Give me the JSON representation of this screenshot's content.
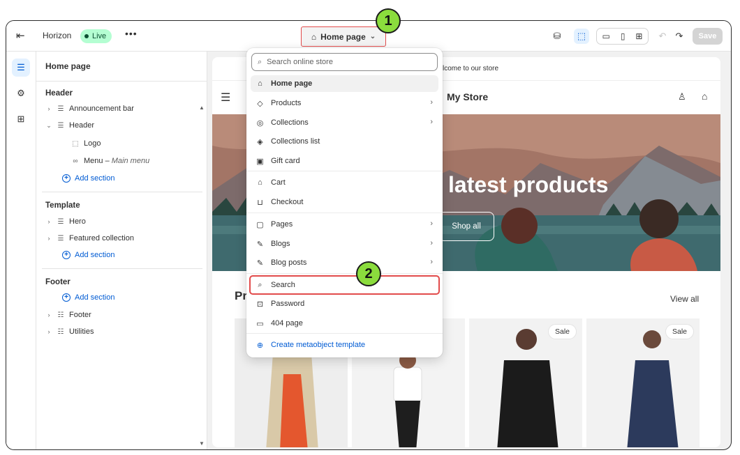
{
  "colors": {
    "accent_blue": "#005bd3",
    "live_badge_bg": "#b4fed2",
    "highlight_red": "#e24b4b",
    "marker_green": "#8bdc3d"
  },
  "topbar": {
    "exit_icon": "exit-icon",
    "theme_name": "Horizon",
    "live_label": "Live",
    "more_icon": "•••",
    "page_selector_label": "Home page",
    "save_label": "Save",
    "icons": [
      "theme-inspector-icon",
      "select-element-icon",
      "desktop-icon",
      "mobile-icon",
      "fullscreen-icon",
      "undo-icon",
      "redo-icon"
    ]
  },
  "rail": {
    "items": [
      "sections-icon",
      "settings-icon",
      "apps-icon"
    ]
  },
  "sidebar": {
    "title": "Home page",
    "groups": {
      "header": {
        "label": "Header",
        "announcement_bar": "Announcement bar",
        "header": "Header",
        "logo": "Logo",
        "menu": "Menu",
        "menu_sub": "Main menu",
        "menu_sep": " – ",
        "add_section": "Add section"
      },
      "template": {
        "label": "Template",
        "hero": "Hero",
        "featured_collection": "Featured collection",
        "add_section": "Add section"
      },
      "footer": {
        "label": "Footer",
        "add_section": "Add section",
        "footer": "Footer",
        "utilities": "Utilities"
      }
    }
  },
  "preview": {
    "announcement": "lcome to our store",
    "store_name": "My Store",
    "hero_title": "latest products",
    "shop_all": "Shop all",
    "products_title": "Pr",
    "view_all": "View all",
    "sale_badge": "Sale"
  },
  "dropdown": {
    "search_placeholder": "Search online store",
    "items": [
      {
        "label": "Home page",
        "icon": "home-icon"
      },
      {
        "label": "Products",
        "icon": "tag-icon"
      },
      {
        "label": "Collections",
        "icon": "collections-icon"
      },
      {
        "label": "Collections list",
        "icon": "collections-list-icon"
      },
      {
        "label": "Gift card",
        "icon": "gift-card-icon"
      },
      {
        "label": "Cart",
        "icon": "cart-icon"
      },
      {
        "label": "Checkout",
        "icon": "checkout-icon"
      },
      {
        "label": "Pages",
        "icon": "page-icon"
      },
      {
        "label": "Blogs",
        "icon": "blog-icon"
      },
      {
        "label": "Blog posts",
        "icon": "blog-post-icon"
      },
      {
        "label": "Search",
        "icon": "search-icon"
      },
      {
        "label": "Password",
        "icon": "lock-icon"
      },
      {
        "label": "404 page",
        "icon": "not-found-icon"
      },
      {
        "label": "Create metaobject template",
        "icon": "plus-circle-icon"
      }
    ]
  },
  "markers": {
    "step1": "1",
    "step2": "2"
  }
}
